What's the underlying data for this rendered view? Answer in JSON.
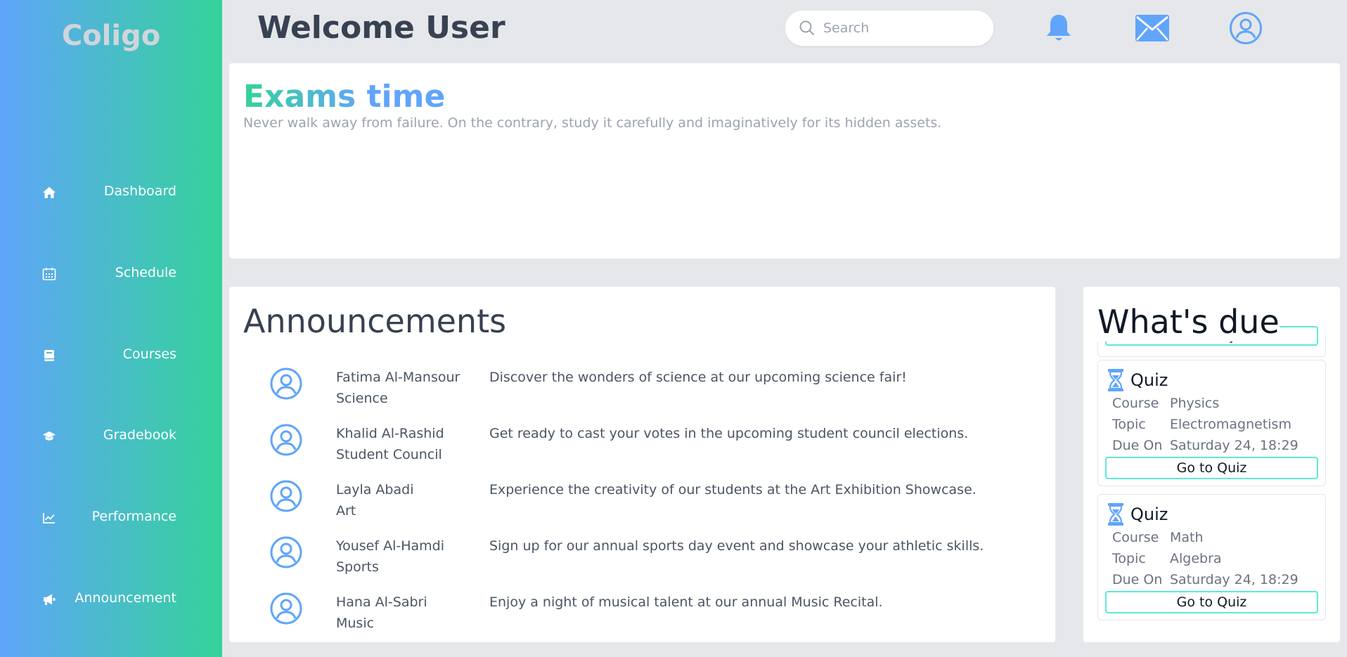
{
  "sidebar": {
    "logo": "Coligo",
    "items": [
      {
        "label": "Dashboard",
        "icon": "home-icon"
      },
      {
        "label": "Schedule",
        "icon": "calendar-icon"
      },
      {
        "label": "Courses",
        "icon": "book-icon"
      },
      {
        "label": "Gradebook",
        "icon": "graduation-cap-icon"
      },
      {
        "label": "Performance",
        "icon": "chart-line-icon"
      },
      {
        "label": "Announcement",
        "icon": "megaphone-icon"
      }
    ]
  },
  "header": {
    "title": "Welcome User",
    "search_placeholder": "Search",
    "icons": [
      "bell-icon",
      "mail-icon",
      "user-circle-icon"
    ],
    "accent_color": "#60a5fa"
  },
  "banner": {
    "title": "Exams time",
    "subtitle": "Never walk away from failure. On the contrary, study it carefully and imaginatively for its hidden assets."
  },
  "announcements": {
    "title": "Announcements",
    "items": [
      {
        "name": "Fatima Al-Mansour",
        "subject": "Science",
        "message": "Discover the wonders of science at our upcoming science fair!"
      },
      {
        "name": "Khalid Al-Rashid",
        "subject": "Student Council",
        "message": "Get ready to cast your votes in the upcoming student council elections."
      },
      {
        "name": "Layla Abadi",
        "subject": "Art",
        "message": "Experience the creativity of our students at the Art Exhibition Showcase."
      },
      {
        "name": "Yousef Al-Hamdi",
        "subject": "Sports",
        "message": "Sign up for our annual sports day event and showcase your athletic skills."
      },
      {
        "name": "Hana Al-Sabri",
        "subject": "Music",
        "message": "Enjoy a night of musical talent at our annual Music Recital."
      }
    ]
  },
  "due": {
    "title": "What's due",
    "partial_button": "Go to Project",
    "course_label": "Course",
    "topic_label": "Topic",
    "due_label": "Due On",
    "items": [
      {
        "type": "Quiz",
        "course": "Physics",
        "topic": "Electromagnetism",
        "due_on": "Saturday 24, 18:29",
        "button": "Go to Quiz"
      },
      {
        "type": "Quiz",
        "course": "Math",
        "topic": "Algebra",
        "due_on": "Saturday 24, 18:29",
        "button": "Go to Quiz"
      }
    ]
  }
}
